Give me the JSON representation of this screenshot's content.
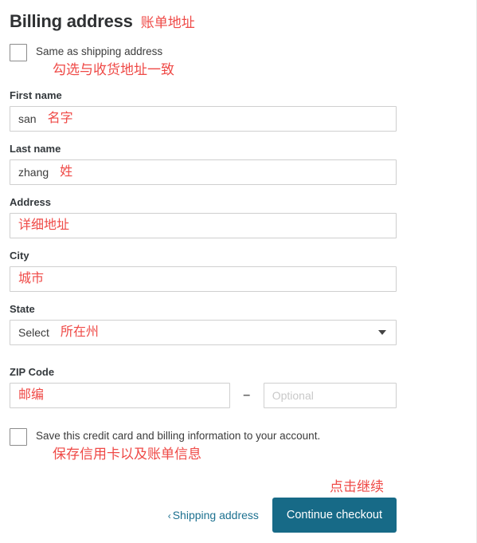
{
  "page": {
    "title": "Billing address",
    "title_annotation": "账单地址"
  },
  "same_as_shipping": {
    "label": "Same as shipping address",
    "annotation": "勾选与收货地址一致",
    "checked": false
  },
  "fields": {
    "first_name": {
      "label": "First name",
      "value": "san",
      "annotation": "名字"
    },
    "last_name": {
      "label": "Last name",
      "value": "zhang",
      "annotation": "姓"
    },
    "address": {
      "label": "Address",
      "value": "",
      "annotation": "详细地址"
    },
    "city": {
      "label": "City",
      "value": "",
      "annotation": "城市"
    },
    "state": {
      "label": "State",
      "value": "Select",
      "annotation": "所在州",
      "options": [
        "Select"
      ]
    },
    "zip": {
      "label": "ZIP Code",
      "value": "",
      "annotation": "邮编",
      "separator": "–",
      "optional_placeholder": "Optional",
      "optional_value": ""
    }
  },
  "save_card": {
    "label": "Save this credit card and billing information to your account.",
    "annotation": "保存信用卡以及账单信息",
    "checked": false
  },
  "footer": {
    "annotation": "点击继续",
    "shipping_link": "Shipping address",
    "shipping_chevron": "‹",
    "continue_label": "Continue checkout"
  },
  "colors": {
    "annotation_red": "#ef4a47",
    "button_teal": "#176a87",
    "link_teal": "#1d7190",
    "field_border": "#cfcfcf"
  }
}
